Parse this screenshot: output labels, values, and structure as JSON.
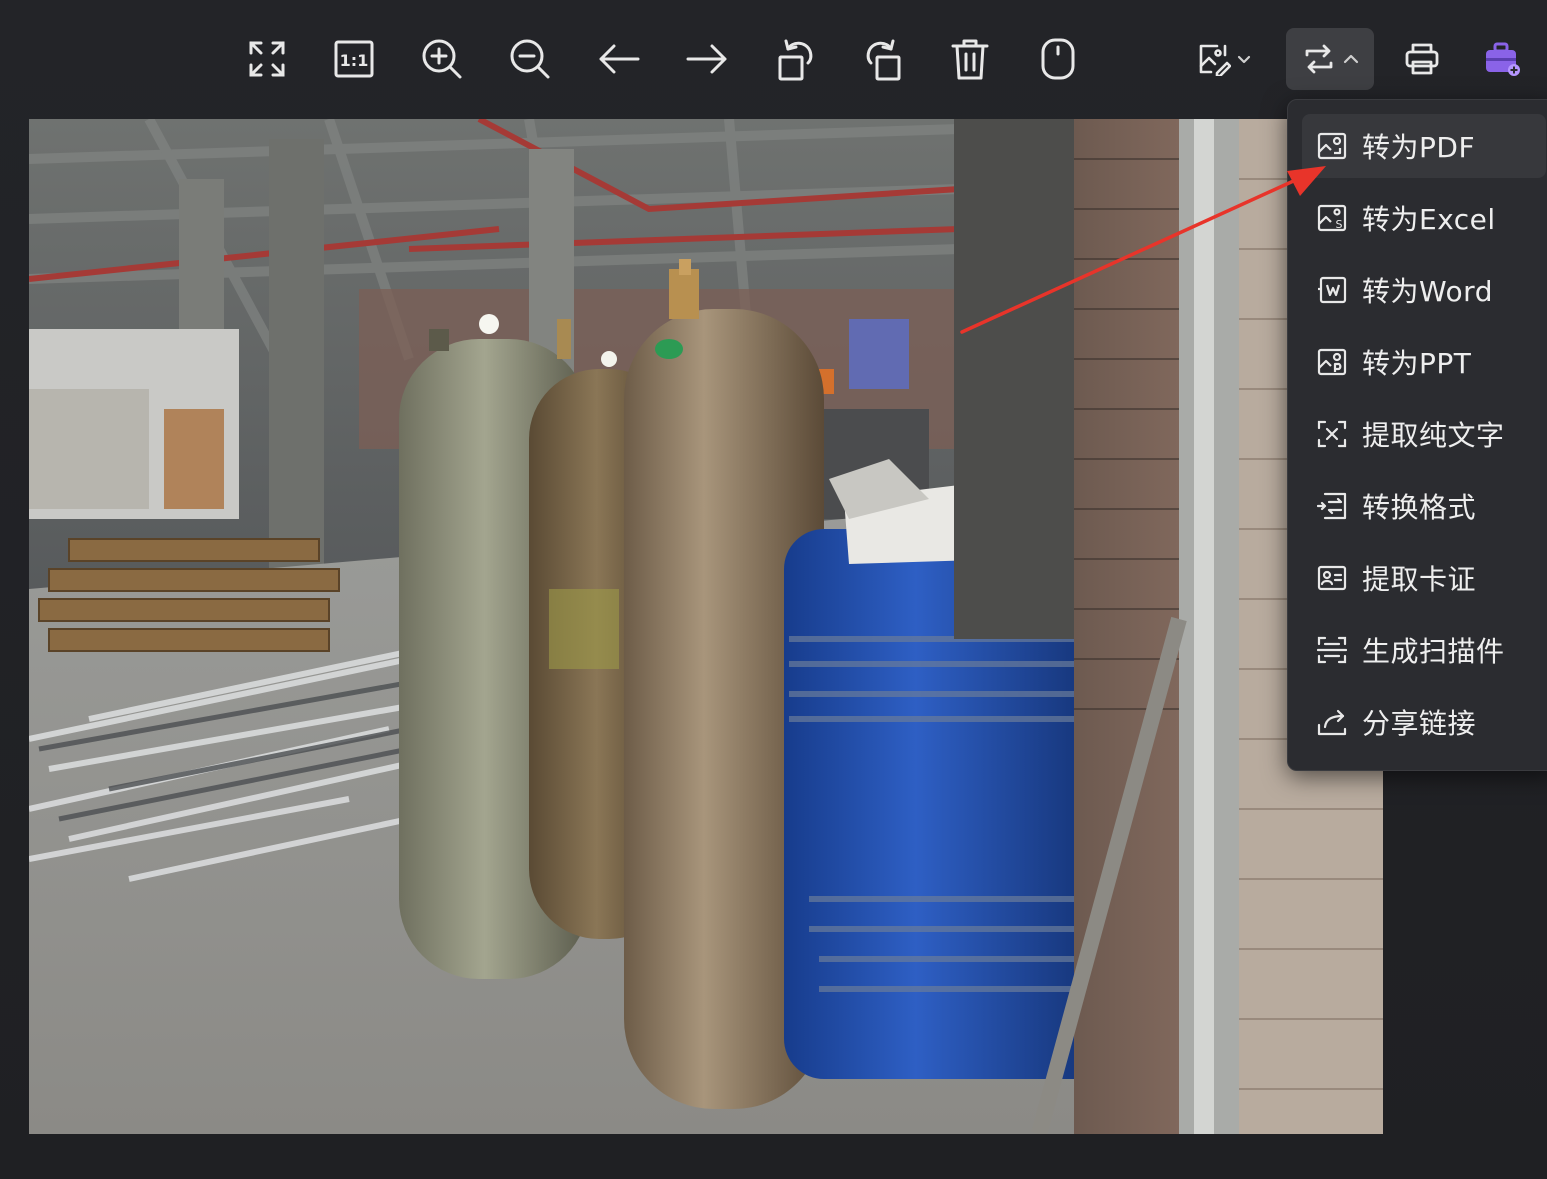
{
  "toolbar": {
    "buttons": [
      {
        "name": "fullscreen-icon",
        "label": "Fullscreen"
      },
      {
        "name": "actual-size-icon",
        "label": "1:1"
      },
      {
        "name": "zoom-in-icon",
        "label": "Zoom in"
      },
      {
        "name": "zoom-out-icon",
        "label": "Zoom out"
      },
      {
        "name": "previous-arrow-icon",
        "label": "Previous"
      },
      {
        "name": "next-arrow-icon",
        "label": "Next"
      },
      {
        "name": "rotate-left-icon",
        "label": "Rotate left"
      },
      {
        "name": "rotate-right-icon",
        "label": "Rotate right"
      },
      {
        "name": "trash-icon",
        "label": "Delete"
      },
      {
        "name": "mouse-icon",
        "label": "Mouse mode"
      },
      {
        "name": "image-edit-icon",
        "label": "Edit image"
      },
      {
        "name": "convert-icon",
        "label": "Convert"
      },
      {
        "name": "printer-icon",
        "label": "Print"
      },
      {
        "name": "toolbox-icon",
        "label": "Toolbox"
      }
    ],
    "actual_size_text": "1:1"
  },
  "menu": {
    "items": [
      {
        "label": "转为PDF",
        "icon": "pdf-image-icon"
      },
      {
        "label": "转为Excel",
        "icon": "excel-image-icon"
      },
      {
        "label": "转为Word",
        "icon": "word-image-icon"
      },
      {
        "label": "转为PPT",
        "icon": "ppt-image-icon"
      },
      {
        "label": "提取纯文字",
        "icon": "extract-text-icon"
      },
      {
        "label": "转换格式",
        "icon": "convert-format-icon"
      },
      {
        "label": "提取卡证",
        "icon": "id-card-icon"
      },
      {
        "label": "生成扫描件",
        "icon": "scan-icon"
      },
      {
        "label": "分享链接",
        "icon": "share-icon"
      }
    ]
  },
  "colors": {
    "background": "#232428",
    "icon": "#e8e8e8",
    "accent_purple": "#8a63e8",
    "annotation_arrow": "#e8342a",
    "menu_bg": "#2b2c30"
  }
}
